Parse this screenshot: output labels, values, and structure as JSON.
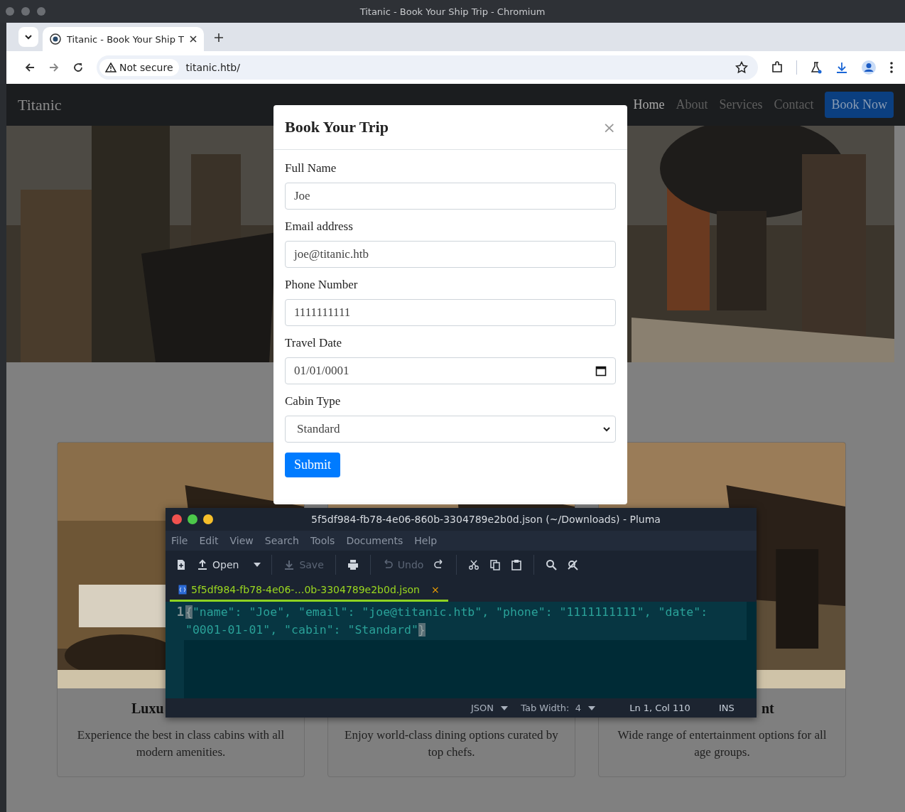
{
  "os_window": {
    "title": "Titanic - Book Your Ship Trip - Chromium"
  },
  "browser": {
    "tabs": [
      {
        "title": "Titanic - Book Your Ship T",
        "selected": true
      }
    ],
    "security": "Not secure",
    "url": "titanic.htb/"
  },
  "site": {
    "brand": "Titanic",
    "nav": [
      {
        "label": "Home",
        "selected": true
      },
      {
        "label": "About",
        "selected": false
      },
      {
        "label": "Services",
        "selected": false
      },
      {
        "label": "Contact",
        "selected": false
      }
    ],
    "cta": "Book Now"
  },
  "cards": [
    {
      "title": "Luxu",
      "text": "Experience the best in class cabins with all modern amenities."
    },
    {
      "text": "Enjoy world-class dining options curated by top chefs."
    },
    {
      "title": "nt",
      "text": "Wide range of entertainment options for all age groups."
    }
  ],
  "modal": {
    "title": "Book Your Trip",
    "close": "×",
    "fields": [
      {
        "label": "Full Name",
        "kind": "text",
        "value": "Joe"
      },
      {
        "label": "Email address",
        "kind": "text",
        "value": "joe@titanic.htb"
      },
      {
        "label": "Phone Number",
        "kind": "text",
        "value": "1111111111"
      },
      {
        "label": "Travel Date",
        "kind": "date",
        "value": "01/01/0001"
      },
      {
        "label": "Cabin Type",
        "kind": "select",
        "value": "Standard"
      }
    ],
    "submit": "Submit"
  },
  "editor": {
    "title": "5f5df984-fb78-4e06-860b-3304789e2b0d.json (~/Downloads) - Pluma",
    "menu": [
      "File",
      "Edit",
      "View",
      "Search",
      "Tools",
      "Documents",
      "Help"
    ],
    "toolbar": [
      {
        "kind": "new",
        "disabled": false
      },
      {
        "kind": "open",
        "label": "Open",
        "disabled": false
      },
      {
        "kind": "save",
        "label": "Save",
        "disabled": true
      },
      {
        "kind": "print",
        "disabled": false
      },
      {
        "kind": "undo",
        "label": "Undo",
        "disabled": true
      },
      {
        "kind": "redo",
        "disabled": false
      },
      {
        "kind": "cut",
        "disabled": false
      },
      {
        "kind": "copy",
        "disabled": false
      },
      {
        "kind": "paste",
        "disabled": false
      },
      {
        "kind": "search",
        "disabled": false
      },
      {
        "kind": "replace",
        "disabled": false
      }
    ],
    "tab": {
      "title": "5f5df984-fb78-4e06-…0b-3304789e2b0d.json",
      "close": "×"
    },
    "lines": [
      {
        "number": "1",
        "text": "{\"name\": \"Joe\", \"email\": \"joe@titanic.htb\", \"phone\": \"1111111111\", \"date\": \"0001-01-01\", \"cabin\": \"Standard\"}"
      }
    ],
    "status": {
      "language": "JSON",
      "tab_width": "Tab Width:  4",
      "position": "Ln 1, Col 110",
      "mode": "INS"
    }
  }
}
